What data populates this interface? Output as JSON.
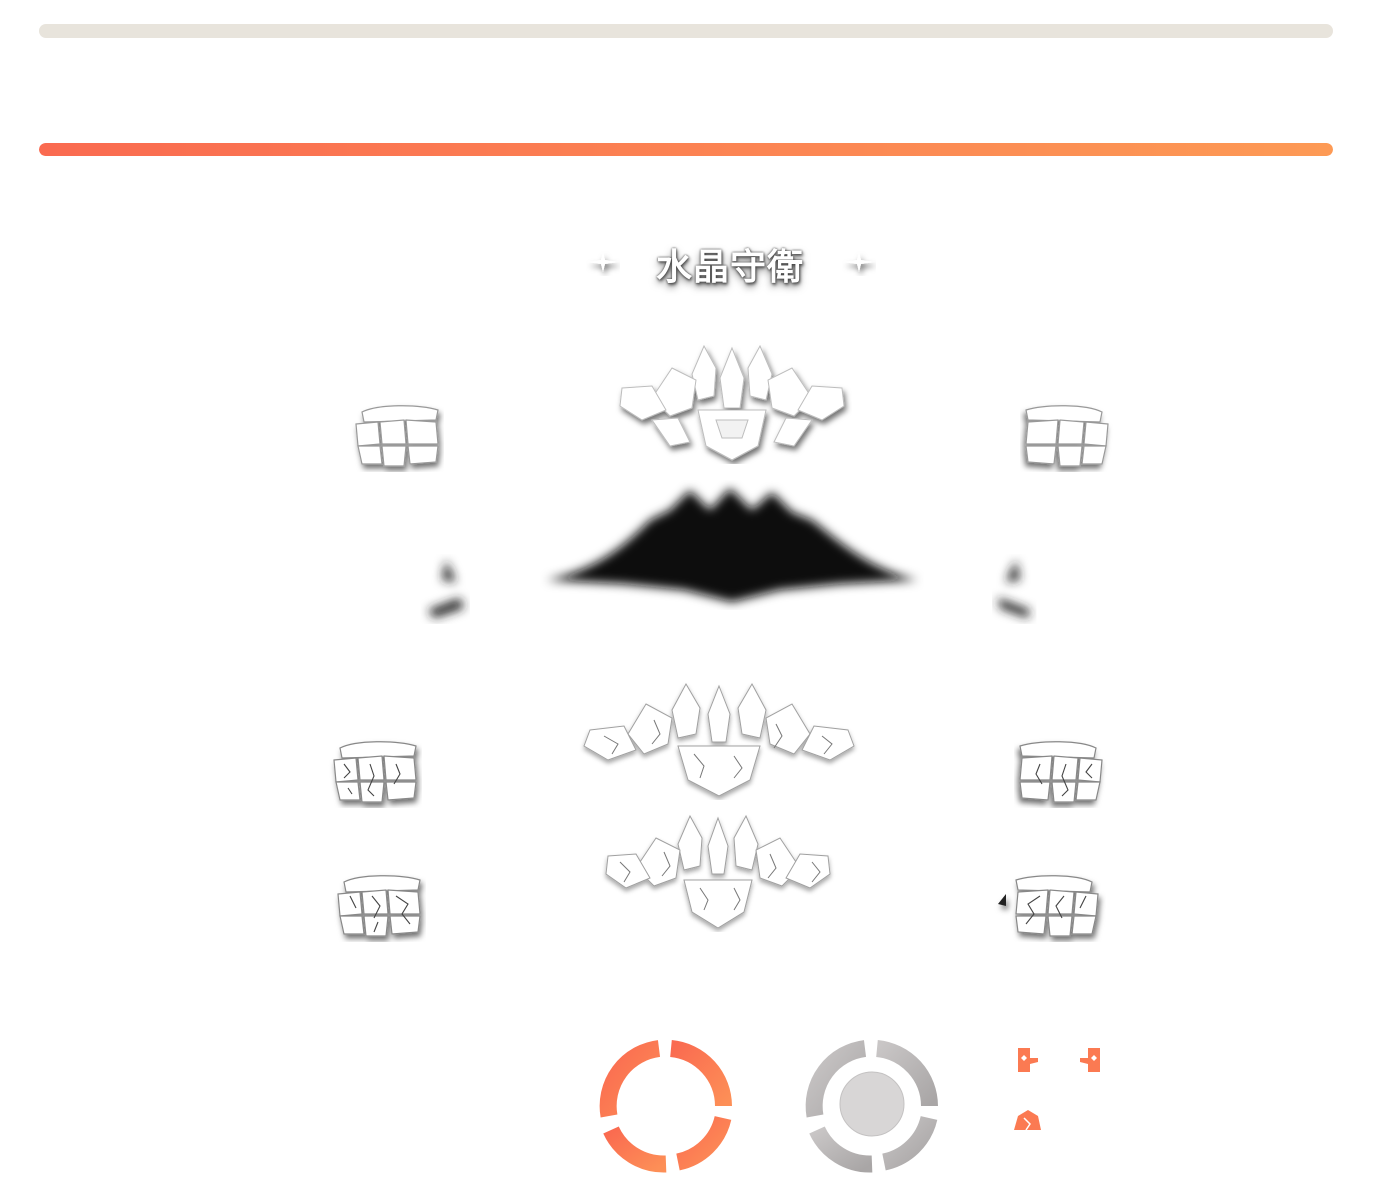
{
  "title": {
    "text": "水晶守衛"
  },
  "colors": {
    "accent_start": "#fa6a50",
    "accent_end": "#fd9a55",
    "track": "#e8e4dc",
    "stone": "#ffffff",
    "shadow": "#111111",
    "grey_ring": "#b9b6b6"
  },
  "progress": {
    "top_bar_fill": 0,
    "accent_bar_fill": 1
  },
  "icons": {
    "title_ornament_left": "star-ornament-icon",
    "title_ornament_right": "star-ornament-icon",
    "ring_orange": "orange-ring-icon",
    "ring_grey": "grey-ring-icon",
    "glove_left": "glove-icon",
    "glove_right": "glove-icon",
    "rock": "rock-icon"
  }
}
